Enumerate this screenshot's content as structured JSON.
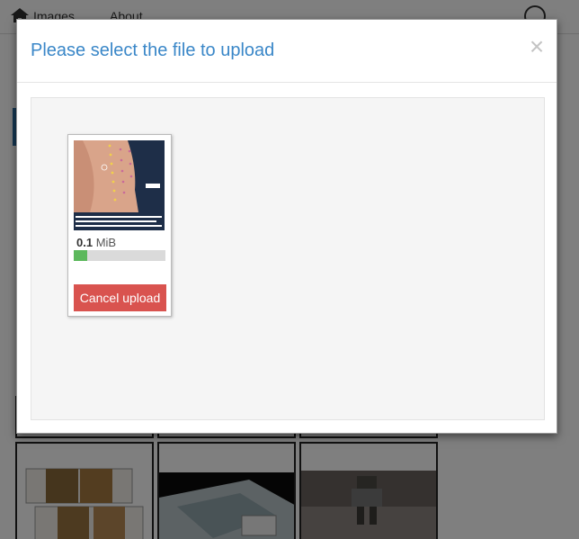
{
  "background": {
    "nav": {
      "images_label": "Images",
      "about_label": "About"
    }
  },
  "modal": {
    "title": "Please select the file to upload",
    "close_symbol": "×"
  },
  "upload": {
    "file": {
      "size_value": "0.1",
      "size_unit": "MiB",
      "progress_fraction": 0.15
    },
    "cancel_label": "Cancel upload"
  },
  "colors": {
    "title": "#3a87c8",
    "cancel_button": "#d9534f",
    "progress_fill": "#5cb85c"
  }
}
